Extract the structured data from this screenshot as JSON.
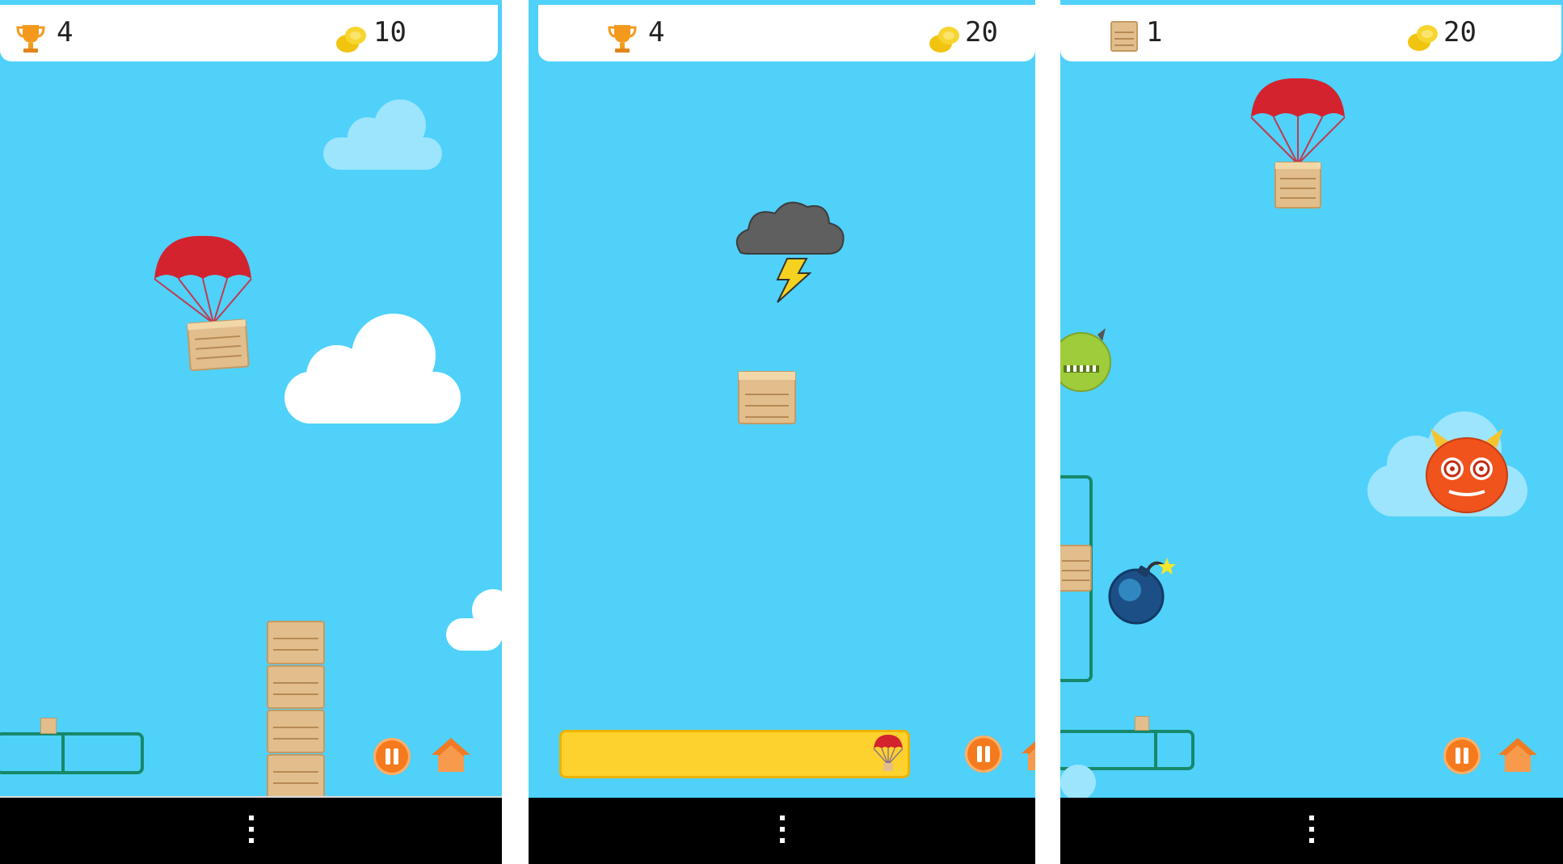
{
  "screens": [
    {
      "hud": {
        "left_icon": "trophy-icon",
        "left_value": "4",
        "right_icon": "coin-icon",
        "right_value": "10"
      },
      "controls": {
        "pause_icon": "pause-icon",
        "home_icon": "home-icon"
      }
    },
    {
      "hud": {
        "left_icon": "trophy-icon",
        "left_value": "4",
        "right_icon": "coin-icon",
        "right_value": "20"
      },
      "controls": {
        "pause_icon": "pause-icon",
        "home_icon": "home-icon"
      },
      "power_meter": {
        "level": 1.0,
        "icon": "parachute-icon",
        "color": "#fdd22e"
      }
    },
    {
      "hud": {
        "left_icon": "crate-icon",
        "left_value": "1",
        "right_icon": "coin-icon",
        "right_value": "20"
      },
      "controls": {
        "pause_icon": "pause-icon",
        "home_icon": "home-icon"
      }
    }
  ],
  "colors": {
    "sky": "#4fd1fa",
    "pause": "#f57a1e",
    "home": "#f07b22",
    "parachute": "#d3232f",
    "crate": "#e2be8c",
    "frame": "#17886b"
  }
}
